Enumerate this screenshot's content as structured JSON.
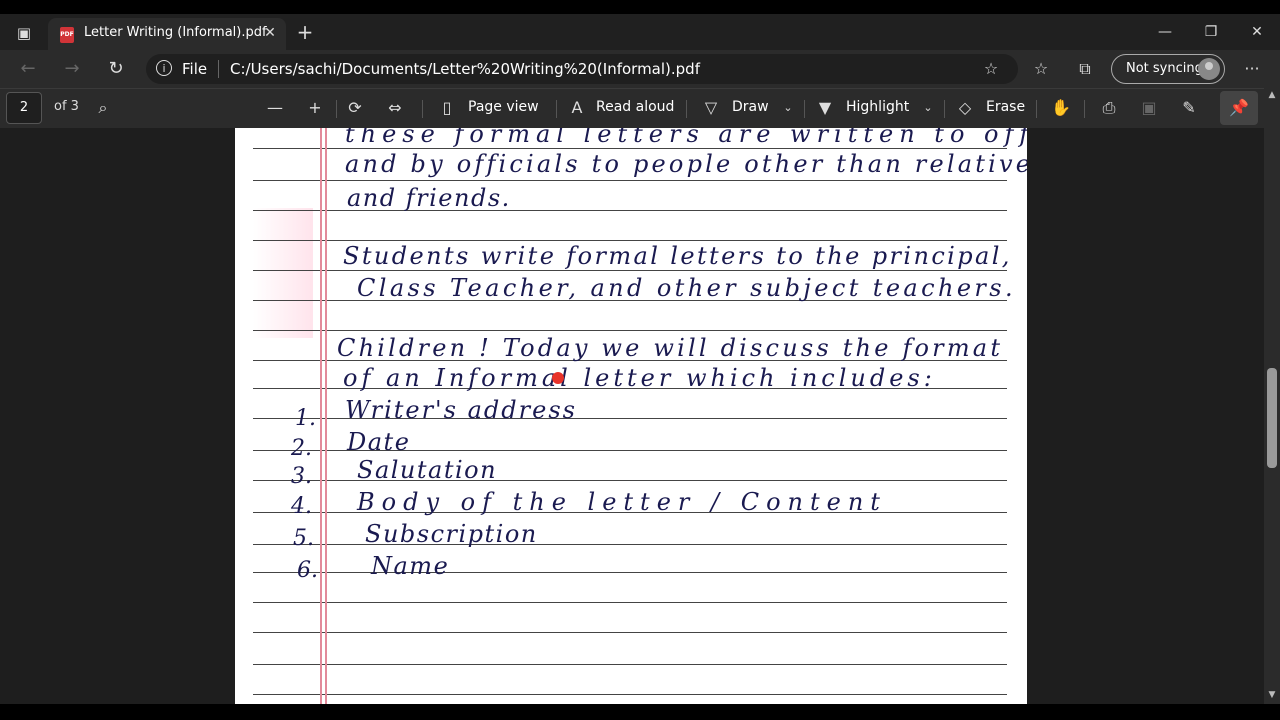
{
  "tab": {
    "title": "Letter Writing (Informal).pdf",
    "pdf_badge": "PDF"
  },
  "window": {
    "minimize": "—",
    "restore": "❐",
    "close": "✕"
  },
  "address": {
    "file_label": "File",
    "url": "C:/Users/sachi/Documents/Letter%20Writing%20(Informal).pdf",
    "sync_label": "Not syncing"
  },
  "pdf_toolbar": {
    "page_number": "2",
    "page_of": "of 3",
    "page_view": "Page view",
    "read_aloud": "Read aloud",
    "draw": "Draw",
    "highlight": "Highlight",
    "erase": "Erase"
  },
  "document": {
    "lines": [
      "these formal letters are written to officials",
      "and by officials to people other than relatives",
      "and friends.",
      "Students write formal letters to the principal,",
      "Class Teacher, and other subject teachers.",
      "Children ! Today we will discuss the format",
      "of an Informal letter which includes:"
    ],
    "list_numbers": [
      "1.",
      "2.",
      "3.",
      "4.",
      "5.",
      "6."
    ],
    "list_items": [
      "Writer's address",
      "Date",
      "Salutation",
      "Body of the letter / Content",
      "Subscription",
      "Name"
    ]
  },
  "colors": {
    "ink": "#1a1a50",
    "margin": "#e28a9a",
    "cursor": "#e8332a"
  }
}
